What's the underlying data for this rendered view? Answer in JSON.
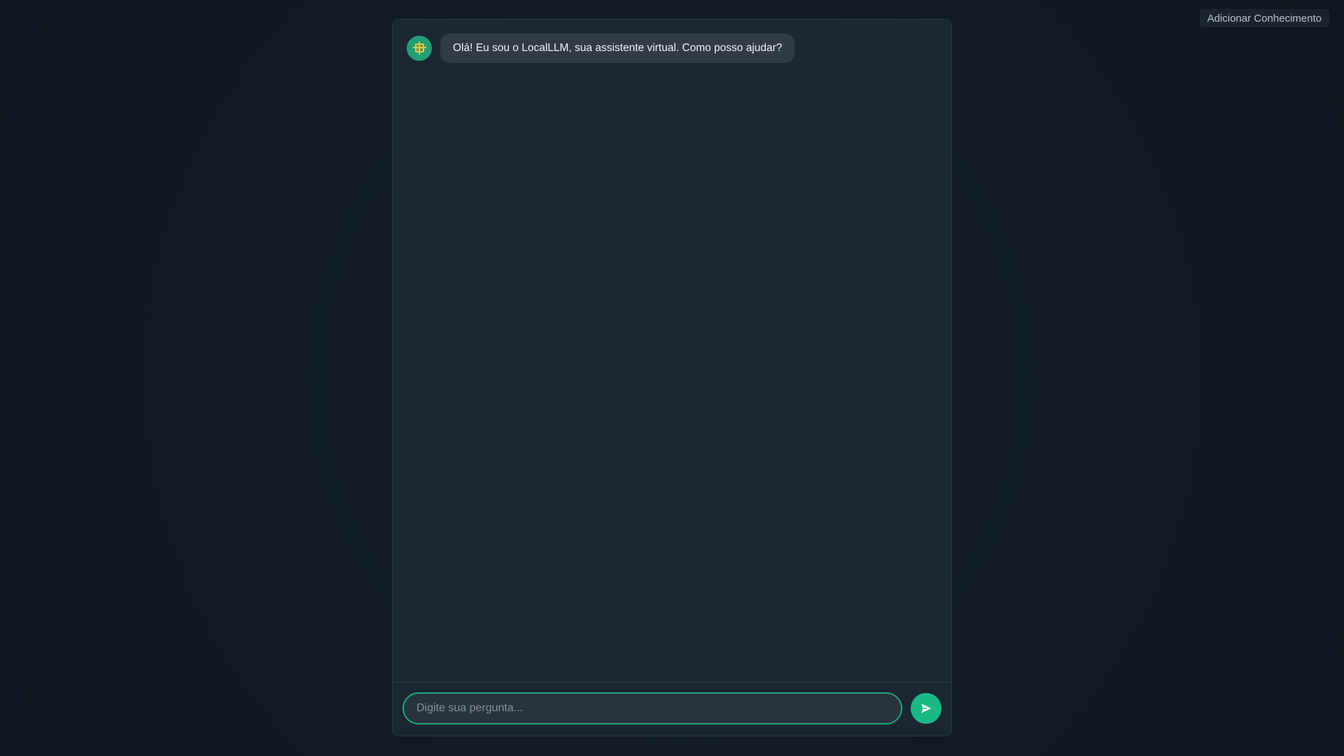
{
  "top_action": {
    "label": "Adicionar Conhecimento"
  },
  "chat": {
    "messages": [
      {
        "sender": "assistant",
        "avatar_icon": "chip-icon",
        "text": "Olá! Eu sou o LocalLLM, sua assistente virtual. Como posso ajudar?"
      }
    ],
    "input": {
      "value": "",
      "placeholder": "Digite sua pergunta..."
    },
    "send_icon": "send-icon"
  },
  "colors": {
    "accent": "#19b984",
    "background": "#121c27",
    "panel": "#1b2732",
    "message_bubble": "#303b46"
  }
}
